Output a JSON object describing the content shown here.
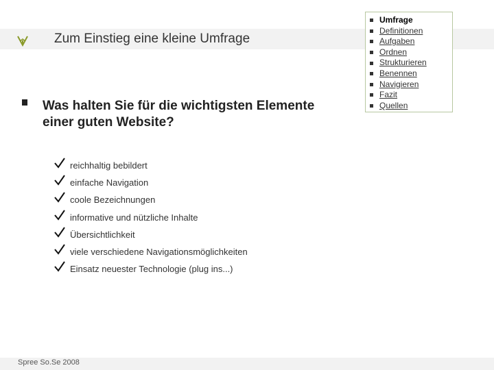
{
  "slide": {
    "title": "Zum Einstieg eine kleine Umfrage",
    "question": "Was halten Sie für die wichtigsten Elemente einer guten Website?",
    "answers": [
      "reichhaltig bebildert",
      "einfache Navigation",
      "coole Bezeichnungen",
      "informative und nützliche Inhalte",
      "Übersichtlichkeit",
      "viele verschiedene Navigationsmöglichkeiten",
      "Einsatz neuester Technologie (plug ins...)"
    ],
    "footer": "Spree So.Se 2008"
  },
  "nav": {
    "items": [
      {
        "label": "Umfrage",
        "current": true
      },
      {
        "label": "Definitionen",
        "current": false
      },
      {
        "label": "Aufgaben",
        "current": false
      },
      {
        "label": "Ordnen",
        "current": false
      },
      {
        "label": "Strukturieren",
        "current": false
      },
      {
        "label": "Benennen",
        "current": false
      },
      {
        "label": "Navigieren",
        "current": false
      },
      {
        "label": "Fazit",
        "current": false
      },
      {
        "label": "Quellen",
        "current": false
      }
    ]
  },
  "icons": {
    "title_marker": "arrow-icon",
    "answer_marker": "checkmark-icon",
    "bullet": "square-bullet-icon"
  },
  "colors": {
    "accent": "#8a9a2a",
    "nav_border": "#b7c7a0",
    "band": "#f2f2f2"
  }
}
